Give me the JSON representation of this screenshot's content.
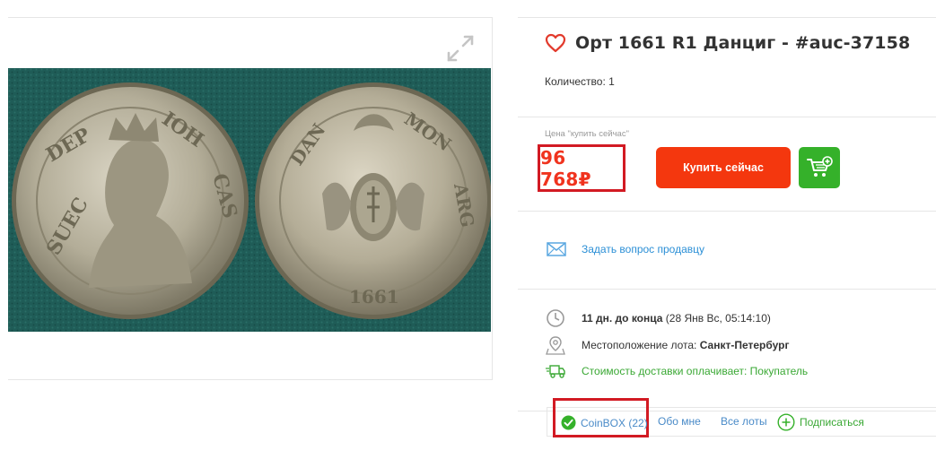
{
  "product": {
    "title": "Орт 1661 R1 Данциг - #auc-37158",
    "quantity_text": "Количество: 1",
    "price_caption": "Цена \"купить сейчас\"",
    "price": "96 768₽",
    "buy_label": "Купить сейчас"
  },
  "seller_contact": {
    "ask_label": "Задать вопрос продавцу"
  },
  "lot_info": {
    "time_left_bold": "11 дн. до конца",
    "time_left_detail": " (28 Янв Вс, 05:14:10)",
    "location_label": "Местоположение лота: ",
    "location_value": "Санкт-Петербург",
    "shipping_text": "Стоимость доставки оплачивает: Покупатель"
  },
  "seller_bar": {
    "name": "CoinBOX (22)",
    "about": "Обо мне",
    "all_lots": "Все лоты",
    "subscribe": "Подписаться"
  },
  "colors": {
    "accent_red": "#f4370e",
    "price_red": "#f0331e",
    "highlight_border": "#d21a23",
    "cart_green": "#35b12a",
    "link_blue": "#2b8fd6",
    "shipping_green": "#3aa834",
    "photo_background": "#1d5a55"
  },
  "icons": [
    "expand-icon",
    "heart-icon",
    "cart-plus-icon",
    "mail-icon",
    "clock-icon",
    "map-pin-icon",
    "truck-icon",
    "verified-check-icon",
    "plus-circle-icon"
  ]
}
